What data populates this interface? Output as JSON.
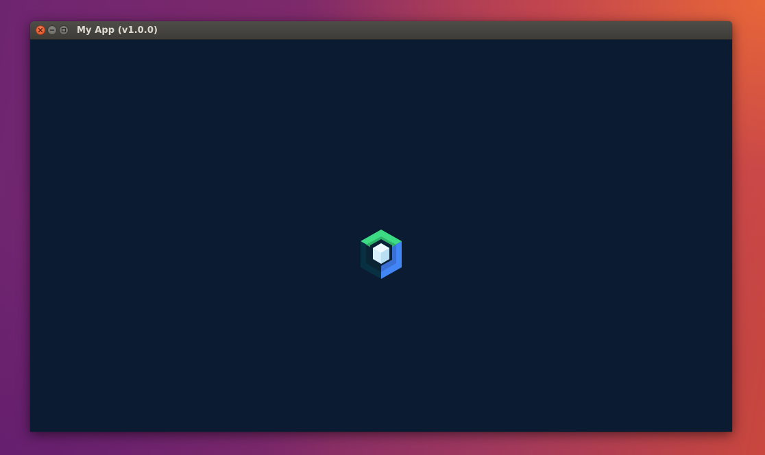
{
  "window": {
    "title": "My App (v1.0.0)",
    "controls": {
      "close_icon": "close-icon",
      "minimize_icon": "minimize-icon",
      "maximize_icon": "maximize-icon"
    }
  },
  "content": {
    "background_color": "#0b1b32",
    "logo_icon": "jetpack-compose-logo-icon"
  },
  "colors": {
    "close_button": "#e3531f",
    "titlebar": "#45443f",
    "logo_green": "#3ddc84",
    "logo_blue": "#4285f4",
    "logo_dark": "#073042",
    "logo_light": "#d6eefb"
  }
}
